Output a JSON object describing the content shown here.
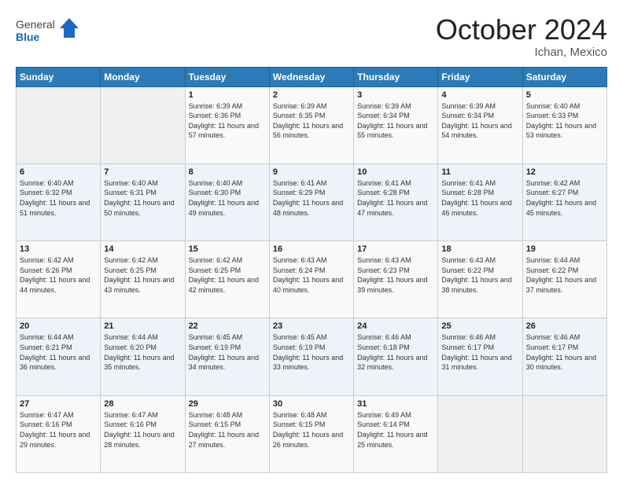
{
  "header": {
    "logo": {
      "general": "General",
      "blue": "Blue"
    },
    "title": "October 2024",
    "location": "Ichan, Mexico"
  },
  "days_of_week": [
    "Sunday",
    "Monday",
    "Tuesday",
    "Wednesday",
    "Thursday",
    "Friday",
    "Saturday"
  ],
  "weeks": [
    [
      {
        "day": "",
        "info": ""
      },
      {
        "day": "",
        "info": ""
      },
      {
        "day": "1",
        "sunrise": "6:39 AM",
        "sunset": "6:36 PM",
        "daylight": "11 hours and 57 minutes."
      },
      {
        "day": "2",
        "sunrise": "6:39 AM",
        "sunset": "6:35 PM",
        "daylight": "11 hours and 56 minutes."
      },
      {
        "day": "3",
        "sunrise": "6:39 AM",
        "sunset": "6:34 PM",
        "daylight": "11 hours and 55 minutes."
      },
      {
        "day": "4",
        "sunrise": "6:39 AM",
        "sunset": "6:34 PM",
        "daylight": "11 hours and 54 minutes."
      },
      {
        "day": "5",
        "sunrise": "6:40 AM",
        "sunset": "6:33 PM",
        "daylight": "11 hours and 53 minutes."
      }
    ],
    [
      {
        "day": "6",
        "sunrise": "6:40 AM",
        "sunset": "6:32 PM",
        "daylight": "11 hours and 51 minutes."
      },
      {
        "day": "7",
        "sunrise": "6:40 AM",
        "sunset": "6:31 PM",
        "daylight": "11 hours and 50 minutes."
      },
      {
        "day": "8",
        "sunrise": "6:40 AM",
        "sunset": "6:30 PM",
        "daylight": "11 hours and 49 minutes."
      },
      {
        "day": "9",
        "sunrise": "6:41 AM",
        "sunset": "6:29 PM",
        "daylight": "11 hours and 48 minutes."
      },
      {
        "day": "10",
        "sunrise": "6:41 AM",
        "sunset": "6:28 PM",
        "daylight": "11 hours and 47 minutes."
      },
      {
        "day": "11",
        "sunrise": "6:41 AM",
        "sunset": "6:28 PM",
        "daylight": "11 hours and 46 minutes."
      },
      {
        "day": "12",
        "sunrise": "6:42 AM",
        "sunset": "6:27 PM",
        "daylight": "11 hours and 45 minutes."
      }
    ],
    [
      {
        "day": "13",
        "sunrise": "6:42 AM",
        "sunset": "6:26 PM",
        "daylight": "11 hours and 44 minutes."
      },
      {
        "day": "14",
        "sunrise": "6:42 AM",
        "sunset": "6:25 PM",
        "daylight": "11 hours and 43 minutes."
      },
      {
        "day": "15",
        "sunrise": "6:42 AM",
        "sunset": "6:25 PM",
        "daylight": "11 hours and 42 minutes."
      },
      {
        "day": "16",
        "sunrise": "6:43 AM",
        "sunset": "6:24 PM",
        "daylight": "11 hours and 40 minutes."
      },
      {
        "day": "17",
        "sunrise": "6:43 AM",
        "sunset": "6:23 PM",
        "daylight": "11 hours and 39 minutes."
      },
      {
        "day": "18",
        "sunrise": "6:43 AM",
        "sunset": "6:22 PM",
        "daylight": "11 hours and 38 minutes."
      },
      {
        "day": "19",
        "sunrise": "6:44 AM",
        "sunset": "6:22 PM",
        "daylight": "11 hours and 37 minutes."
      }
    ],
    [
      {
        "day": "20",
        "sunrise": "6:44 AM",
        "sunset": "6:21 PM",
        "daylight": "11 hours and 36 minutes."
      },
      {
        "day": "21",
        "sunrise": "6:44 AM",
        "sunset": "6:20 PM",
        "daylight": "11 hours and 35 minutes."
      },
      {
        "day": "22",
        "sunrise": "6:45 AM",
        "sunset": "6:19 PM",
        "daylight": "11 hours and 34 minutes."
      },
      {
        "day": "23",
        "sunrise": "6:45 AM",
        "sunset": "6:19 PM",
        "daylight": "11 hours and 33 minutes."
      },
      {
        "day": "24",
        "sunrise": "6:46 AM",
        "sunset": "6:18 PM",
        "daylight": "11 hours and 32 minutes."
      },
      {
        "day": "25",
        "sunrise": "6:46 AM",
        "sunset": "6:17 PM",
        "daylight": "11 hours and 31 minutes."
      },
      {
        "day": "26",
        "sunrise": "6:46 AM",
        "sunset": "6:17 PM",
        "daylight": "11 hours and 30 minutes."
      }
    ],
    [
      {
        "day": "27",
        "sunrise": "6:47 AM",
        "sunset": "6:16 PM",
        "daylight": "11 hours and 29 minutes."
      },
      {
        "day": "28",
        "sunrise": "6:47 AM",
        "sunset": "6:16 PM",
        "daylight": "11 hours and 28 minutes."
      },
      {
        "day": "29",
        "sunrise": "6:48 AM",
        "sunset": "6:15 PM",
        "daylight": "11 hours and 27 minutes."
      },
      {
        "day": "30",
        "sunrise": "6:48 AM",
        "sunset": "6:15 PM",
        "daylight": "11 hours and 26 minutes."
      },
      {
        "day": "31",
        "sunrise": "6:49 AM",
        "sunset": "6:14 PM",
        "daylight": "11 hours and 25 minutes."
      },
      {
        "day": "",
        "info": ""
      },
      {
        "day": "",
        "info": ""
      }
    ]
  ]
}
